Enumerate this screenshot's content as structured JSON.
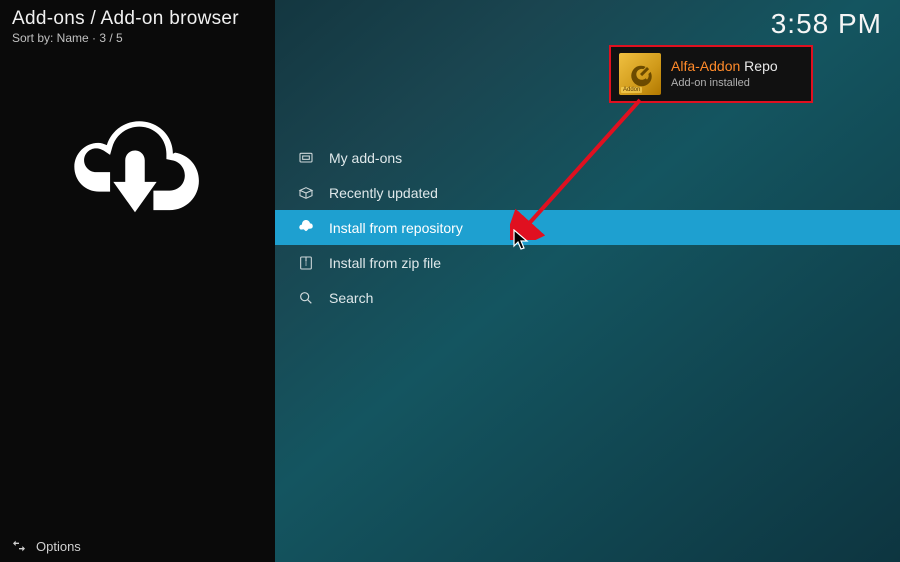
{
  "header": {
    "breadcrumb": "Add-ons / Add-on browser",
    "sortline": "Sort by: Name  ·  3 / 5"
  },
  "clock": "3:58 PM",
  "menu": {
    "items": [
      {
        "label": "My add-ons",
        "icon": "my-addons-icon",
        "selected": false
      },
      {
        "label": "Recently updated",
        "icon": "box-open-icon",
        "selected": false
      },
      {
        "label": "Install from repository",
        "icon": "cloud-download-icon",
        "selected": true
      },
      {
        "label": "Install from zip file",
        "icon": "zip-file-icon",
        "selected": false
      },
      {
        "label": "Search",
        "icon": "search-icon",
        "selected": false
      }
    ]
  },
  "options": {
    "label": "Options"
  },
  "notification": {
    "title_highlight": "Alfa-Addon",
    "title_rest": " Repo",
    "subtitle": "Add-on installed",
    "icon_label": "Addon"
  },
  "colors": {
    "highlight": "#1ea0d0",
    "annotation": "#e01020",
    "notif_accent": "#ff8a2a"
  }
}
